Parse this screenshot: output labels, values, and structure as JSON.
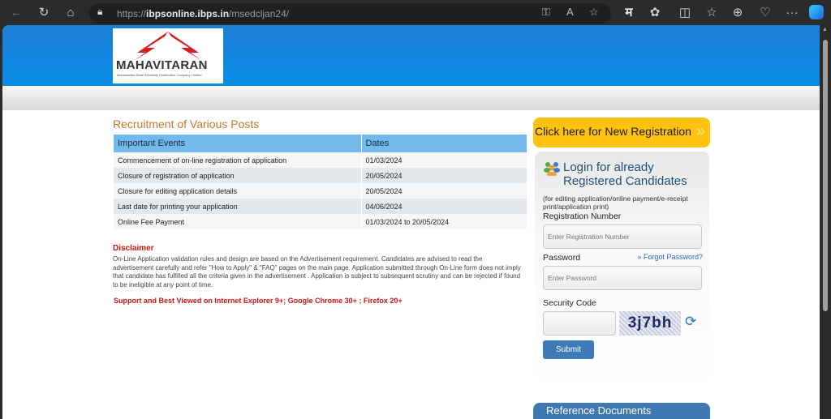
{
  "browser": {
    "url_prefix": "https://",
    "url_domain": "ibpsonline.ibps.in",
    "url_path": "/msedcljan24/",
    "icons": [
      "back-icon",
      "refresh-icon",
      "home-icon",
      "lock-icon",
      "key-icon",
      "read-aloud-icon",
      "favorite-icon",
      "translate-icon",
      "extensions-icon",
      "split-screen-icon",
      "favorites-list-icon",
      "collections-icon",
      "browser-essentials-icon",
      "more-icon",
      "copilot-icon"
    ],
    "translate_glyph": "म",
    "more_glyph": "···"
  },
  "logo": {
    "name_part1": "MAHA",
    "name_part2": "VITARAN",
    "tagline": "Maharashtra State Electricity Distribution Company Limited"
  },
  "main": {
    "title": "Recruitment of Various Posts",
    "table": {
      "headers": [
        "Important Events",
        "Dates"
      ],
      "rows": [
        [
          "Commencement of on-line registration of application",
          "01/03/2024"
        ],
        [
          "Closure of registration of application",
          "20/05/2024"
        ],
        [
          "Closure for editing application details",
          "20/05/2024"
        ],
        [
          "Last date for printing your application",
          "04/06/2024"
        ],
        [
          "Online Fee Payment",
          "01/03/2024 to 20/05/2024"
        ]
      ]
    },
    "disclaimer_heading": "Disclaimer",
    "disclaimer_text": "On-Line Application validation rules and design are based on the Advertisement requirement. Candidates are advised to read the advertisement carefully and refer \"How to Apply\" & \"FAQ\" pages on the main page. Application submitted through On-Line form does not imply that candidate has fulfilled all the criteria given in the advertisement . Application is subject to subsequent scrutiny and can be rejected if found to be ineligible at any point of time.",
    "support_text": "Support and Best Viewed on Internet Explorer 9+; Google Chrome 30+ ; Firefox 20+"
  },
  "sidebar": {
    "new_registration": "Click here for New Registration",
    "new_registration_chevron": "»",
    "login_title_1": "Login for already",
    "login_title_2": "Registered Candidates",
    "login_subtitle": "(for editing application/online payment/e-receipt print/application print)",
    "reg_label": "Registration Number",
    "reg_placeholder": "Enter Registration Number",
    "password_label": "Password",
    "forgot_password": "» Forgot Password?",
    "password_placeholder": "Enter Password",
    "security_label": "Security Code",
    "security_value": "",
    "captcha_text": "3j7bh",
    "submit": "Submit",
    "reference_documents": "Reference Documents"
  }
}
